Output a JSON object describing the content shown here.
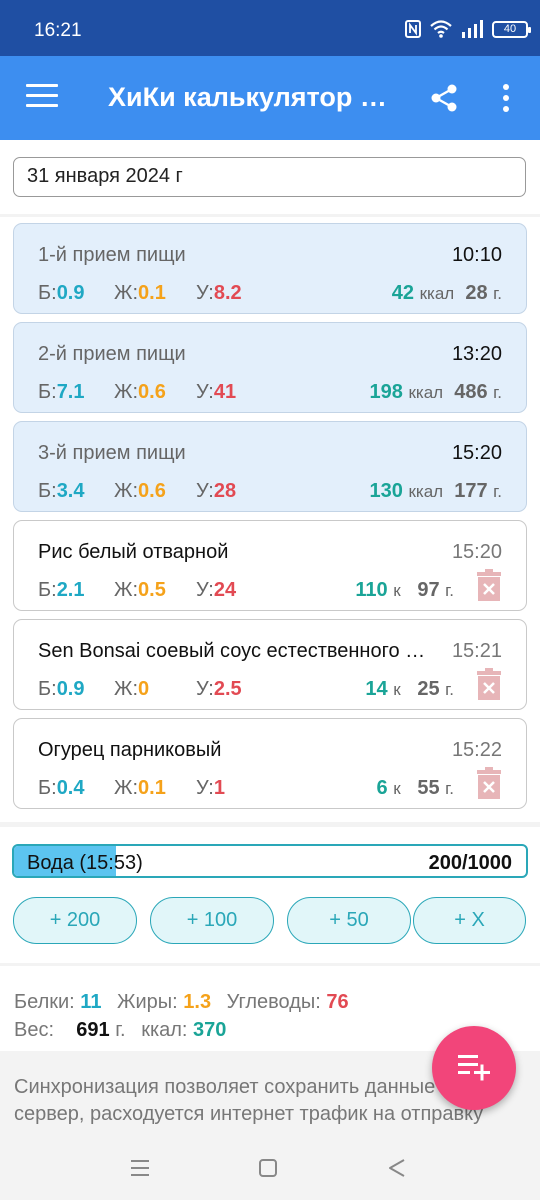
{
  "status_bar": {
    "time": "16:21",
    "battery": "40"
  },
  "app_bar": {
    "title": "ХиКи калькулятор калорий"
  },
  "date": {
    "value": "31 января 2024 г"
  },
  "labels": {
    "protein_short": "Б:",
    "fat_short": "Ж:",
    "carb_short": "У:",
    "kcal_unit": "ккал",
    "kcal_unit_short": "к",
    "gram_unit": "г."
  },
  "meals": [
    {
      "name": "1-й прием пищи",
      "time": "10:10",
      "protein": "0.9",
      "fat": "0.1",
      "carb": "8.2",
      "kcal": "42",
      "grams": "28"
    },
    {
      "name": "2-й прием пищи",
      "time": "13:20",
      "protein": "7.1",
      "fat": "0.6",
      "carb": "41",
      "kcal": "198",
      "grams": "486"
    },
    {
      "name": "3-й прием пищи",
      "time": "15:20",
      "protein": "3.4",
      "fat": "0.6",
      "carb": "28",
      "kcal": "130",
      "grams": "177"
    }
  ],
  "foods": [
    {
      "name": "Рис белый отварной",
      "time": "15:20",
      "protein": "2.1",
      "fat": "0.5",
      "carb": "24",
      "kcal": "110",
      "grams": "97"
    },
    {
      "name": "Sen Bonsai соевый соус естественного брожения",
      "time": "15:21",
      "protein": "0.9",
      "fat": "0",
      "carb": "2.5",
      "kcal": "14",
      "grams": "25"
    },
    {
      "name": "Огурец парниковый",
      "time": "15:22",
      "protein": "0.4",
      "fat": "0.1",
      "carb": "1",
      "kcal": "6",
      "grams": "55"
    }
  ],
  "water": {
    "label": "Вода (15:53)",
    "amount": "200/1000",
    "progress_fraction": 0.2,
    "buttons": [
      "+ 200",
      "+ 100",
      "+ 50",
      "+ X"
    ]
  },
  "summary": {
    "protein_label": "Белки:",
    "protein_value": "11",
    "fat_label": "Жиры:",
    "fat_value": "1.3",
    "carb_label": "Углеводы:",
    "carb_value": "76",
    "weight_label": "Вес:",
    "weight_value": "691",
    "weight_unit": "г.",
    "kcal_label": "ккал:",
    "kcal_value": "370"
  },
  "sync_text": {
    "line1": "Синхронизация позволяет сохранить данные на",
    "line2": "сервер, расходуется интернет трафик на отправку"
  },
  "colors": {
    "status_bar": "#1f4fa3",
    "app_bar": "#3d8ef0",
    "protein": "#1fa8c4",
    "fat": "#f5a21a",
    "carb": "#e24a53",
    "kcal": "#1aa497",
    "fab": "#f2457a",
    "water_fill": "#5cc4f0"
  },
  "icons": [
    "menu-icon",
    "share-icon",
    "more-vert-icon",
    "trash-icon",
    "add-list-icon",
    "nfc-icon",
    "wifi-icon",
    "signal-icon",
    "battery-icon",
    "nav-recents-icon",
    "nav-home-icon",
    "nav-back-icon"
  ]
}
